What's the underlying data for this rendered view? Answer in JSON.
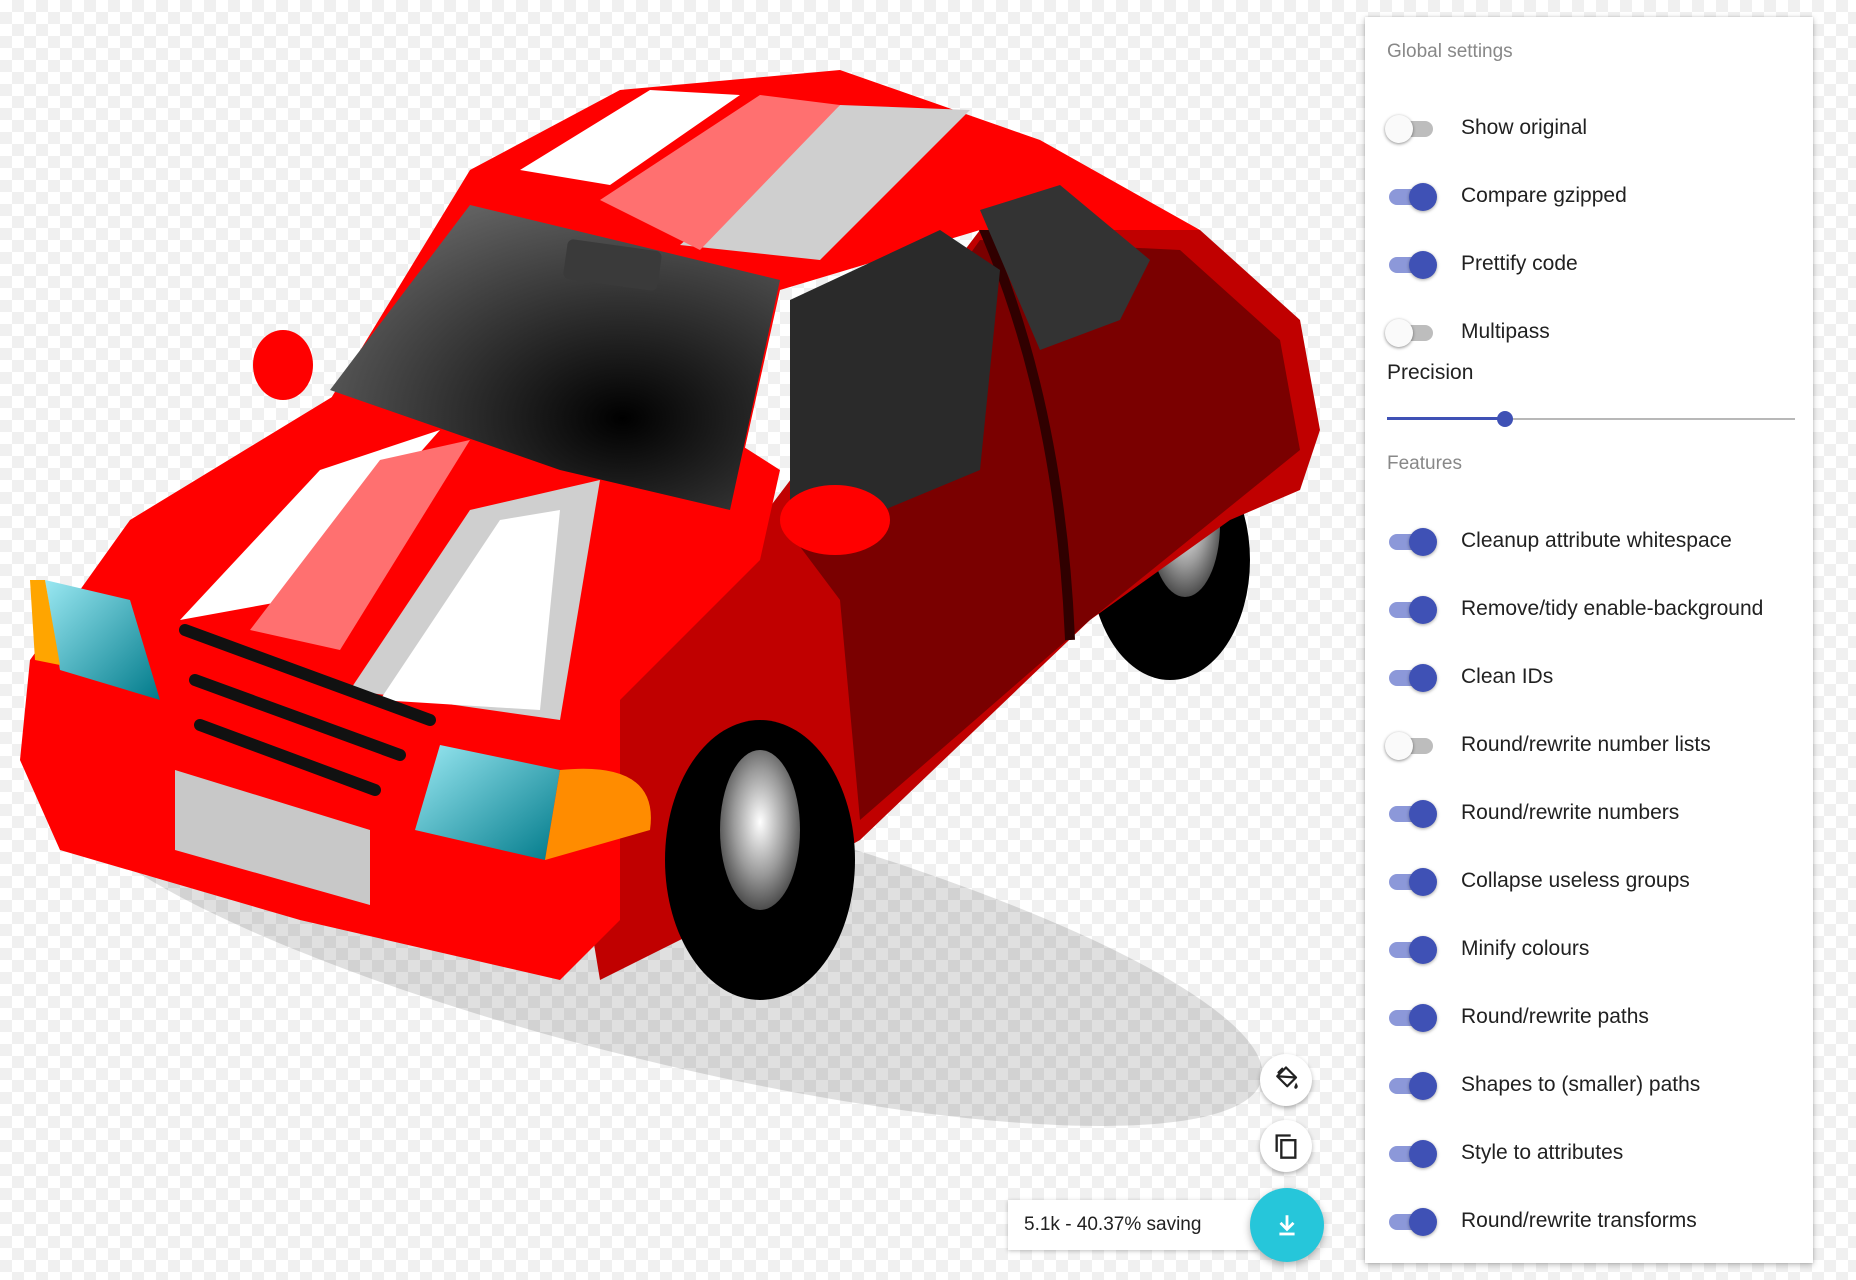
{
  "global_settings": {
    "heading": "Global settings",
    "toggles": [
      {
        "label": "Show original",
        "on": false
      },
      {
        "label": "Compare gzipped",
        "on": true
      },
      {
        "label": "Prettify code",
        "on": true
      },
      {
        "label": "Multipass",
        "on": false
      }
    ],
    "precision": {
      "label": "Precision",
      "value_fraction": 0.29
    }
  },
  "features": {
    "heading": "Features",
    "toggles": [
      {
        "label": "Cleanup attribute whitespace",
        "on": true
      },
      {
        "label": "Remove/tidy enable-background",
        "on": true
      },
      {
        "label": "Clean IDs",
        "on": true
      },
      {
        "label": "Round/rewrite number lists",
        "on": false
      },
      {
        "label": "Round/rewrite numbers",
        "on": true
      },
      {
        "label": "Collapse useless groups",
        "on": true
      },
      {
        "label": "Minify colours",
        "on": true
      },
      {
        "label": "Round/rewrite paths",
        "on": true
      },
      {
        "label": "Shapes to (smaller) paths",
        "on": true
      },
      {
        "label": "Style to attributes",
        "on": true
      },
      {
        "label": "Round/rewrite transforms",
        "on": true
      }
    ]
  },
  "actions": {
    "background_icon": "paint-bucket-icon",
    "copy_icon": "copy-icon",
    "download_icon": "download-icon",
    "result_text": "5.1k - 40.37% saving"
  },
  "colors": {
    "accent": "#3f51b5",
    "accent_track": "#8c98d9",
    "fab": "#26c6da",
    "car_body": "#ff0000"
  }
}
